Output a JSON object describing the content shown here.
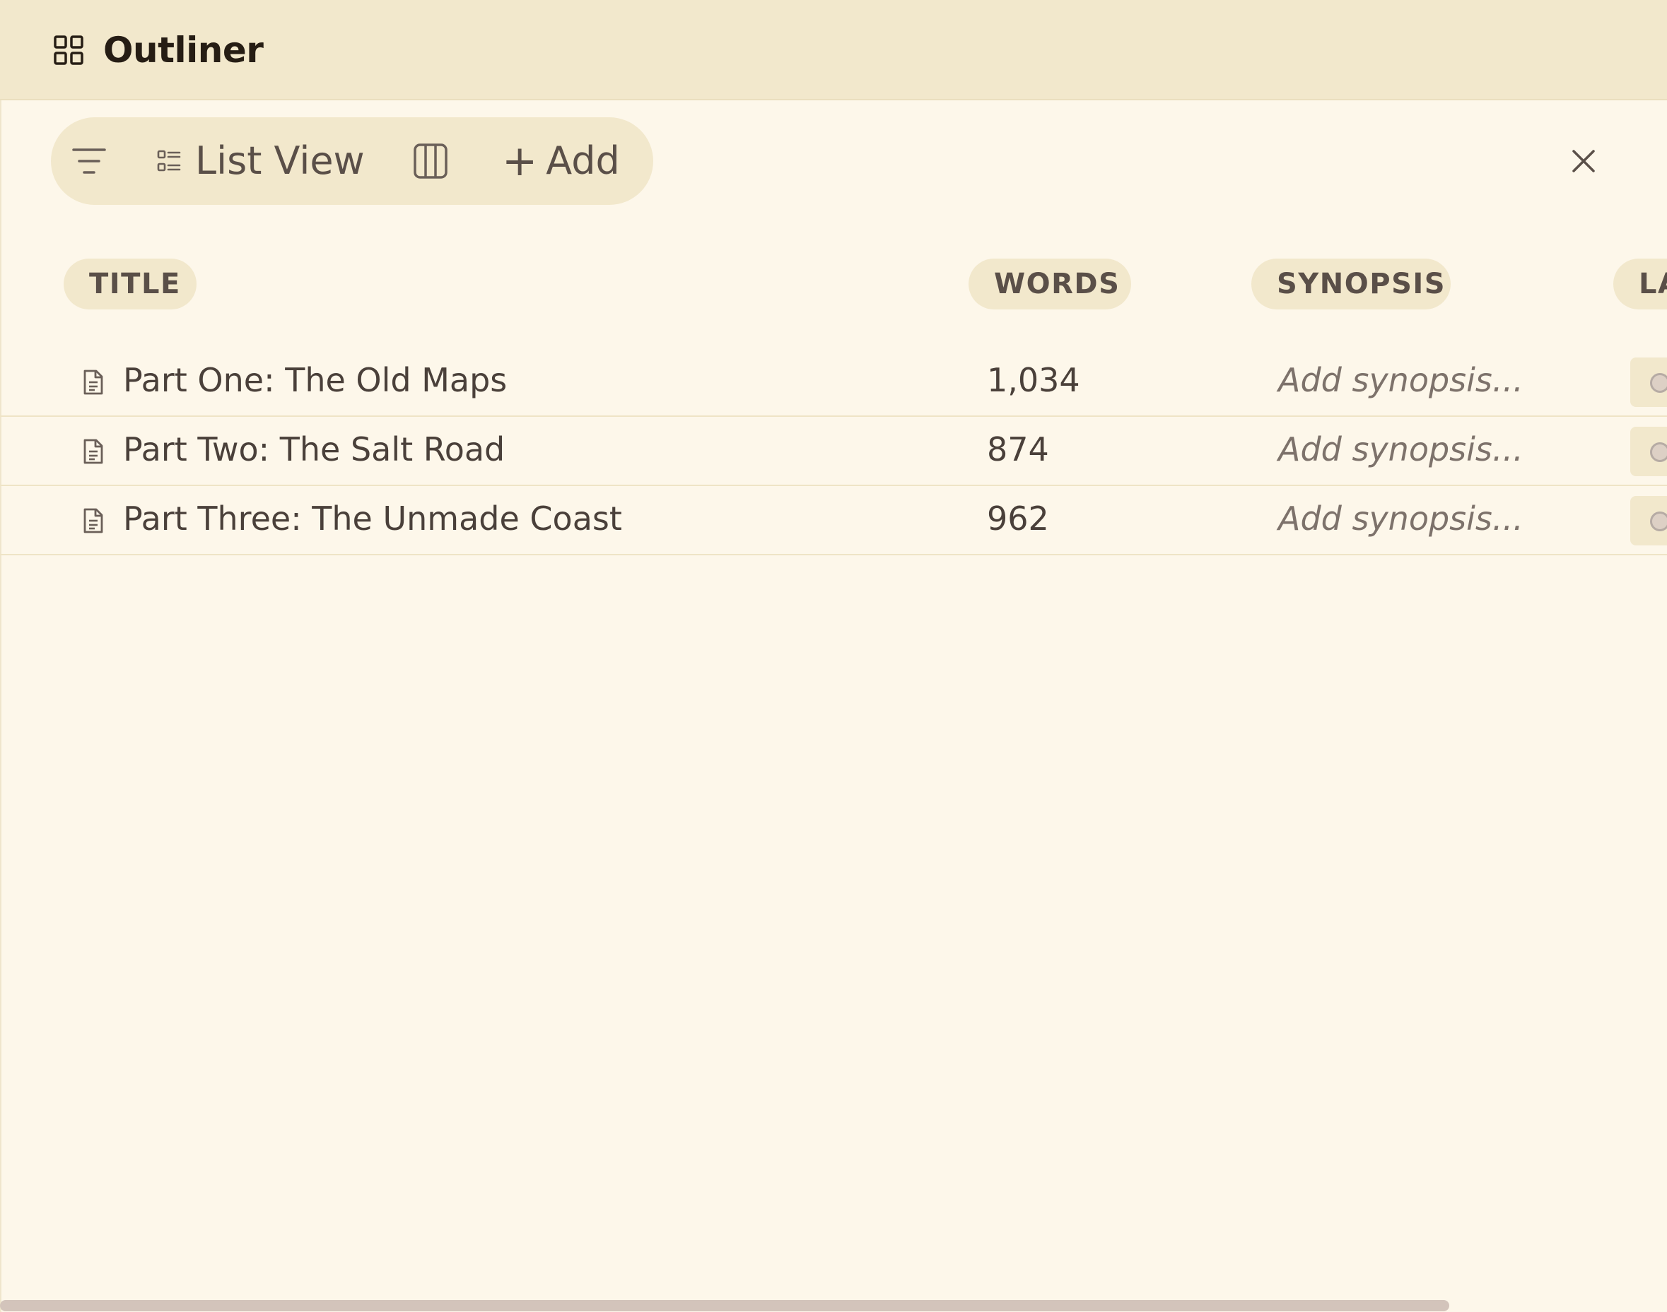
{
  "header": {
    "title": "Outliner",
    "icon": "grid-icon"
  },
  "toolbar": {
    "filter_icon": "filter-icon",
    "list_view_label": "List View",
    "list_view_icon": "list-view-icon",
    "columns_icon": "columns-icon",
    "add_plus": "+",
    "add_label": "Add",
    "close_icon": "close-icon"
  },
  "columns": {
    "title": "TITLE",
    "words": "WORDS",
    "synopsis": "SYNOPSIS",
    "label": "LA"
  },
  "rows": [
    {
      "title": "Part One: The Old Maps",
      "words": "1,034",
      "synopsis": "Add synopsis..."
    },
    {
      "title": "Part Two: The Salt Road",
      "words": "874",
      "synopsis": "Add synopsis..."
    },
    {
      "title": "Part Three: The Unmade Coast",
      "words": "962",
      "synopsis": "Add synopsis..."
    }
  ],
  "colors": {
    "header_bg": "#f2e8cc",
    "page_bg": "#fdf7ea",
    "pill_bg": "#f2e8cc",
    "text": "#4a403a",
    "scrollbar": "#d3c4bb"
  }
}
